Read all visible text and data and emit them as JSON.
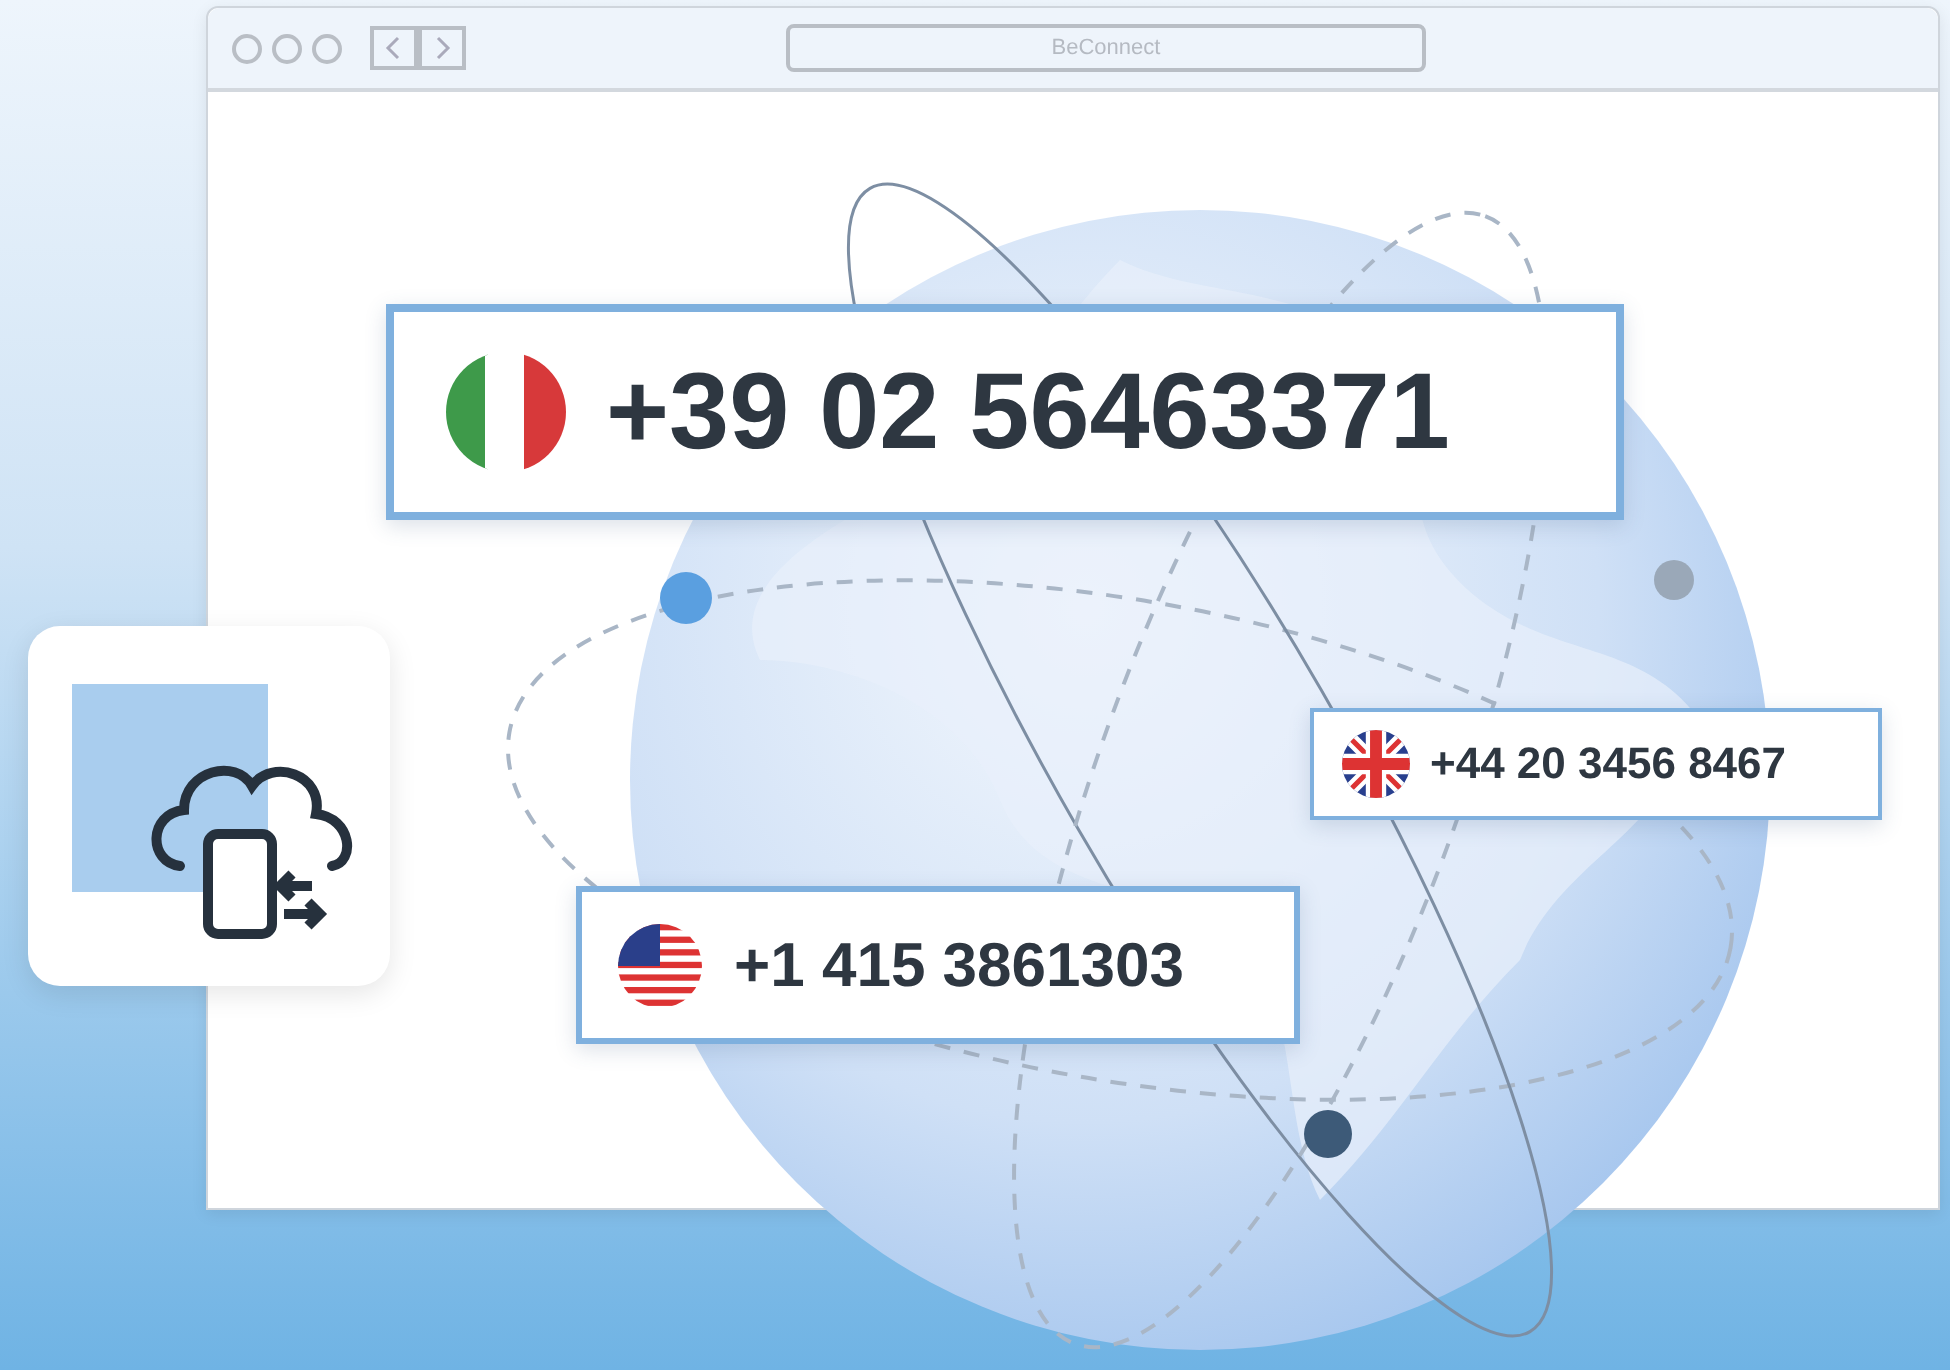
{
  "window": {
    "address": "BeConnect"
  },
  "numbers": [
    {
      "kind": "italy",
      "number": "+39 02 56463371"
    },
    {
      "kind": "uk",
      "number": "+44 20 3456 8467"
    },
    {
      "kind": "usa",
      "number": "+1 415 3861303"
    }
  ]
}
